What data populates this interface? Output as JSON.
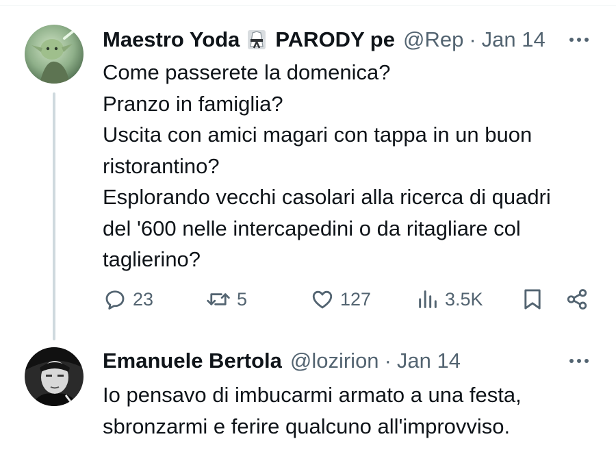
{
  "tweet": {
    "display_name": "Maestro Yoda",
    "label": "PARODY pe",
    "handle": "@Rep",
    "separator": "·",
    "date": "Jan 14",
    "lines": [
      "Come passerete la domenica?",
      "Pranzo in famiglia?",
      "Uscita con amici magari con tappa in un buon",
      "ristorantino?",
      "Esplorando vecchi casolari alla ricerca di quadri",
      "del '600 nelle intercapedini o da ritagliare col",
      "taglierino?"
    ],
    "stats": {
      "replies": "23",
      "retweets": "5",
      "likes": "127",
      "views": "3.5K"
    }
  },
  "reply": {
    "display_name": "Emanuele Bertola",
    "handle": "@lozirion",
    "separator": "·",
    "date": "Jan 14",
    "lines": [
      "Io pensavo di imbucarmi armato a una festa,",
      "sbronzarmi e ferire qualcuno all'improvviso."
    ]
  },
  "colors": {
    "text": "#0f1419",
    "muted": "#536471",
    "thread_line": "#cfd9de"
  },
  "icons": [
    "reply-icon",
    "retweet-icon",
    "like-icon",
    "views-icon",
    "bookmark-icon",
    "share-icon",
    "more-icon",
    "parody-badge-icon"
  ]
}
